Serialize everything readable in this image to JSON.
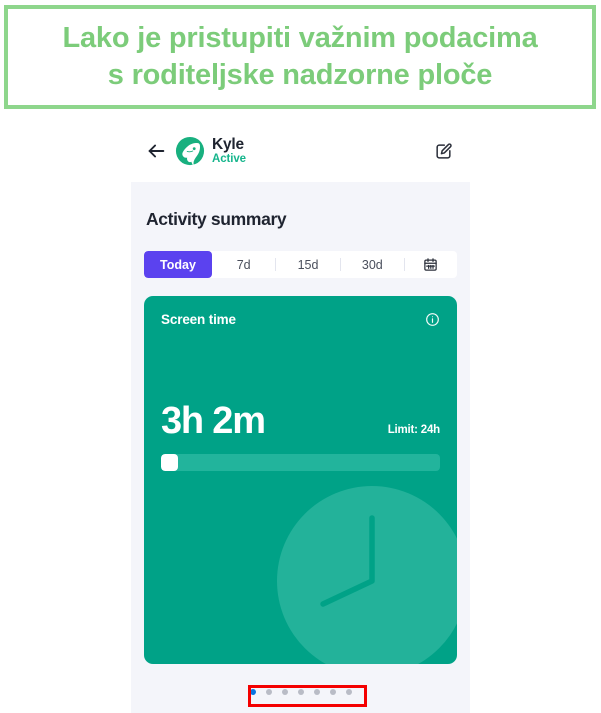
{
  "banner": {
    "caption": "Lako je pristupiti važnim podacima\ns roditeljske nadzorne ploče",
    "border_color": "#8ed68c",
    "text_color": "#7ccc7a"
  },
  "app": {
    "header": {
      "back_icon": "back-arrow-icon",
      "avatar_icon": "dolphin-avatar-icon",
      "user_name": "Kyle",
      "user_status": "Active",
      "status_color": "#16b58c",
      "edit_icon": "edit-pencil-icon"
    },
    "main": {
      "section_title": "Activity summary",
      "range_tabs": [
        {
          "label": "Today",
          "active": true
        },
        {
          "label": "7d",
          "active": false
        },
        {
          "label": "15d",
          "active": false
        },
        {
          "label": "30d",
          "active": false
        }
      ],
      "calendar_icon": "calendar-icon",
      "active_tab_color": "#5b42ef",
      "card": {
        "title": "Screen time",
        "info_icon": "info-circle-icon",
        "value": "3h 2m",
        "limit": "Limit: 24h",
        "progress_percent": 6,
        "background_color": "#00a287",
        "deco_icon": "clock-graphic"
      },
      "carousel": {
        "total_dots": 7,
        "active_index": 0,
        "active_color": "#0a74e0",
        "inactive_color": "#b9bcc6"
      }
    }
  },
  "annotation": {
    "highlight_color": "#f40000",
    "target": "carousel-dots"
  }
}
